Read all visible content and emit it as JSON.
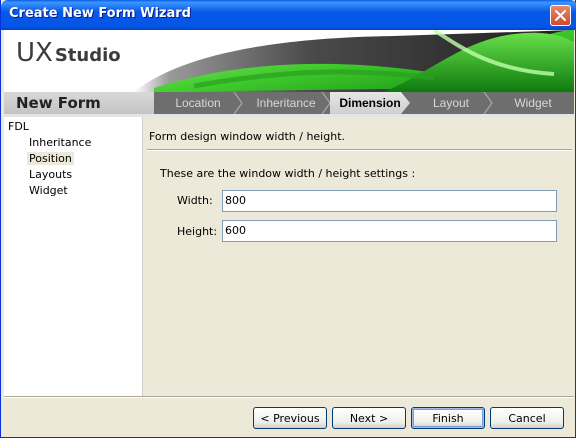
{
  "window": {
    "title": "Create New Form Wizard"
  },
  "banner": {
    "logo_ux": "UX",
    "logo_studio": "Studio",
    "section_title": "New Form",
    "steps": [
      {
        "label": "Location",
        "active": false
      },
      {
        "label": "Inheritance",
        "active": false
      },
      {
        "label": "Dimension",
        "active": true
      },
      {
        "label": "Layout",
        "active": false
      },
      {
        "label": "Widget",
        "active": false
      }
    ]
  },
  "tree": {
    "root": "FDL",
    "items": [
      {
        "label": "Inheritance",
        "selected": false
      },
      {
        "label": "Position",
        "selected": true
      },
      {
        "label": "Layouts",
        "selected": false
      },
      {
        "label": "Widget",
        "selected": false
      }
    ]
  },
  "content": {
    "description": "Form design window width / height.",
    "settings_label": "These are the window width / height settings :",
    "width_label": "Width:",
    "width_value": "800",
    "height_label": "Height:",
    "height_value": "600"
  },
  "buttons": {
    "previous": "< Previous",
    "next": "Next >",
    "finish": "Finish",
    "cancel": "Cancel"
  },
  "colors": {
    "titlebar": "#0558E8",
    "accent_green": "#3FD12A",
    "face": "#ECE9D8"
  }
}
